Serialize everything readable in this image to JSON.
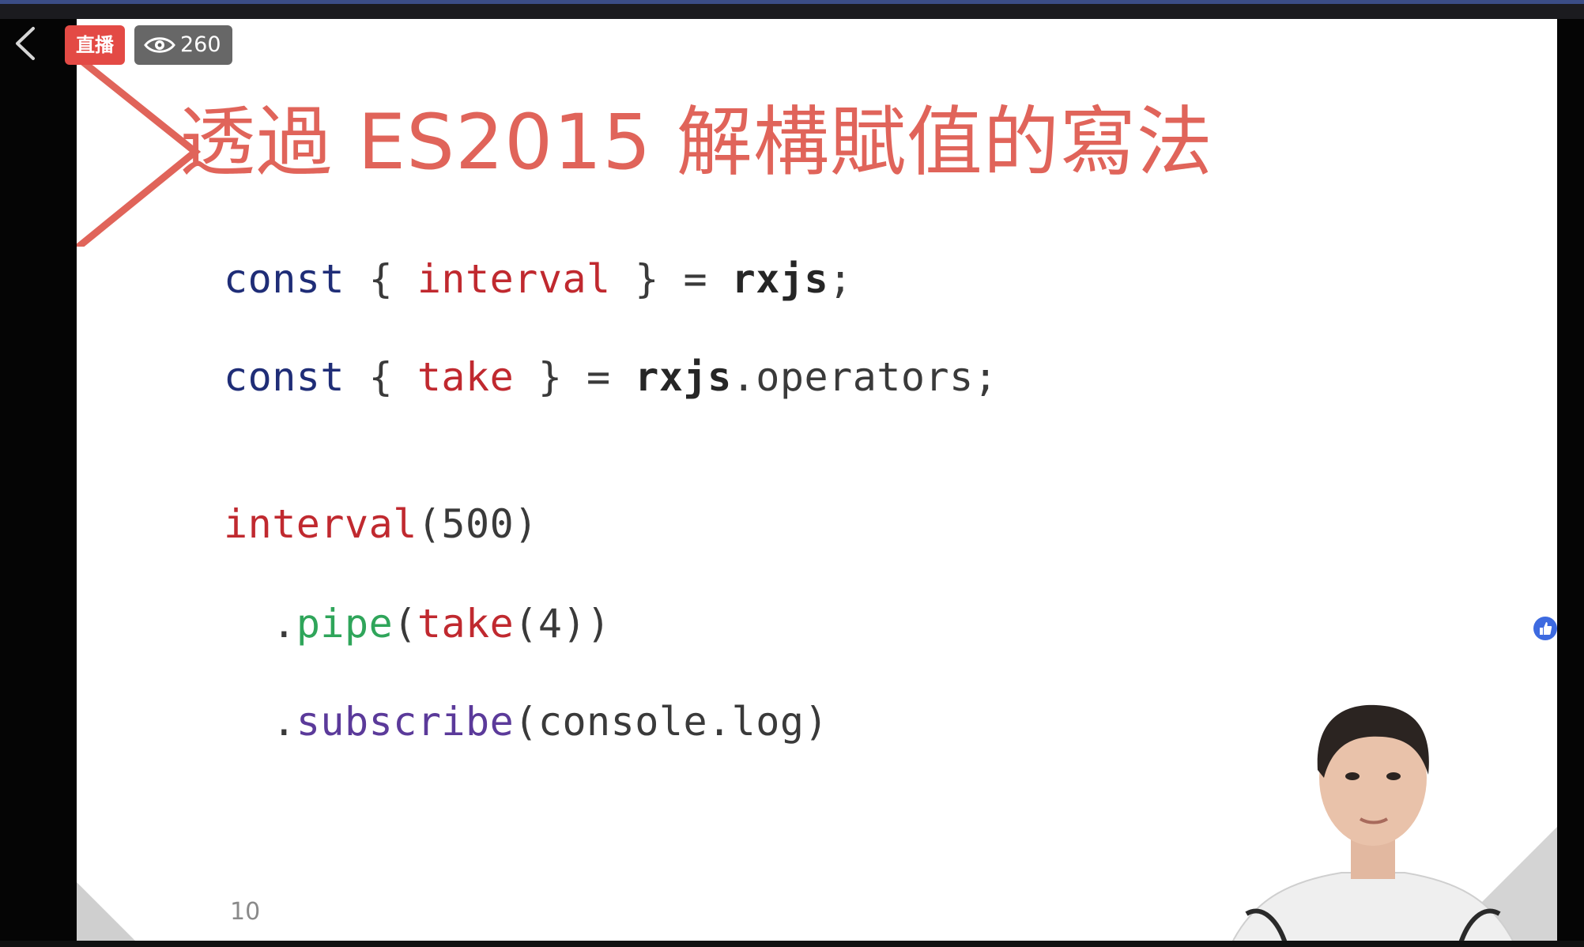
{
  "stream": {
    "live_label": "直播",
    "viewer_count": "260"
  },
  "slide": {
    "title": "透過 ES2015 解構賦值的寫法",
    "page_number": "10",
    "code_lines": [
      {
        "tokens": [
          {
            "text": "const",
            "role": "keyword"
          },
          {
            "text": " { ",
            "role": "punct"
          },
          {
            "text": "interval",
            "role": "red"
          },
          {
            "text": " } = ",
            "role": "punct"
          },
          {
            "text": "rxjs",
            "role": "dark"
          },
          {
            "text": ";",
            "role": "punct"
          }
        ]
      },
      {
        "tokens": [
          {
            "text": "const",
            "role": "keyword"
          },
          {
            "text": " { ",
            "role": "punct"
          },
          {
            "text": "take",
            "role": "red"
          },
          {
            "text": " } = ",
            "role": "punct"
          },
          {
            "text": "rxjs",
            "role": "dark"
          },
          {
            "text": ".operators;",
            "role": "punct"
          }
        ]
      },
      {
        "tokens": [
          {
            "text": "interval",
            "role": "red"
          },
          {
            "text": "(500)",
            "role": "punct"
          }
        ]
      },
      {
        "tokens": [
          {
            "text": "  .",
            "role": "punct"
          },
          {
            "text": "pipe",
            "role": "green"
          },
          {
            "text": "(",
            "role": "punct"
          },
          {
            "text": "take",
            "role": "red"
          },
          {
            "text": "(4))",
            "role": "punct"
          }
        ]
      },
      {
        "tokens": [
          {
            "text": "  .",
            "role": "punct"
          },
          {
            "text": "subscribe",
            "role": "purple"
          },
          {
            "text": "(console.log)",
            "role": "punct"
          }
        ]
      }
    ]
  },
  "icons": {
    "back": "chevron-left-icon",
    "viewers": "eye-icon",
    "like": "thumbs-up-icon"
  },
  "colors": {
    "title": "#e0645a",
    "keyword": "#1f2d77",
    "identifier_red": "#c0292f",
    "pipe_green": "#2fa55a",
    "subscribe_purple": "#5b3a9a",
    "live_badge": "#e34a45",
    "like_badge": "#3d6ae0"
  }
}
